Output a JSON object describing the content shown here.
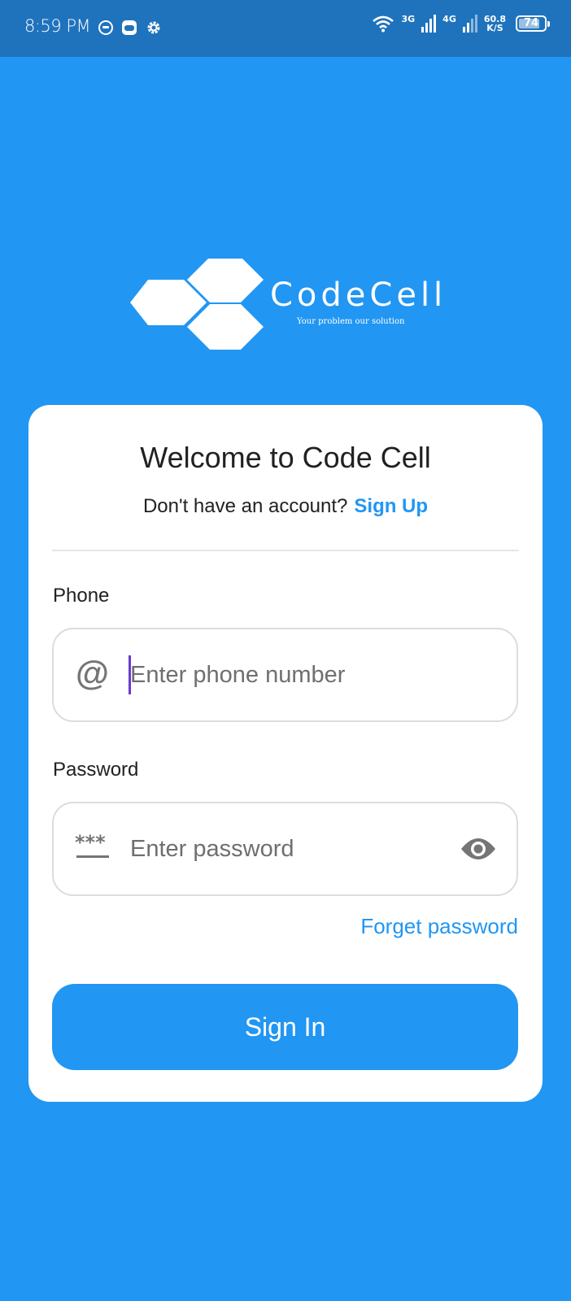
{
  "status_bar": {
    "time": "8:59 PM",
    "network_3g": "3G",
    "network_4g": "4G",
    "speed_value": "60.8",
    "speed_unit": "K/S",
    "battery": "74"
  },
  "logo": {
    "name": "CodeCell",
    "tagline": "Your problem our solution"
  },
  "card": {
    "title": "Welcome to Code Cell",
    "account_prompt": "Don't have an account?",
    "signup_label": "Sign Up"
  },
  "phone": {
    "label": "Phone",
    "placeholder": "Enter phone number",
    "value": ""
  },
  "password": {
    "label": "Password",
    "placeholder": "Enter password",
    "value": ""
  },
  "forget_label": "Forget password",
  "signin_label": "Sign In",
  "colors": {
    "primary": "#2196F3",
    "status_bar": "#1F73BD",
    "card": "#FFFFFF",
    "caret": "#6A3AD1"
  }
}
